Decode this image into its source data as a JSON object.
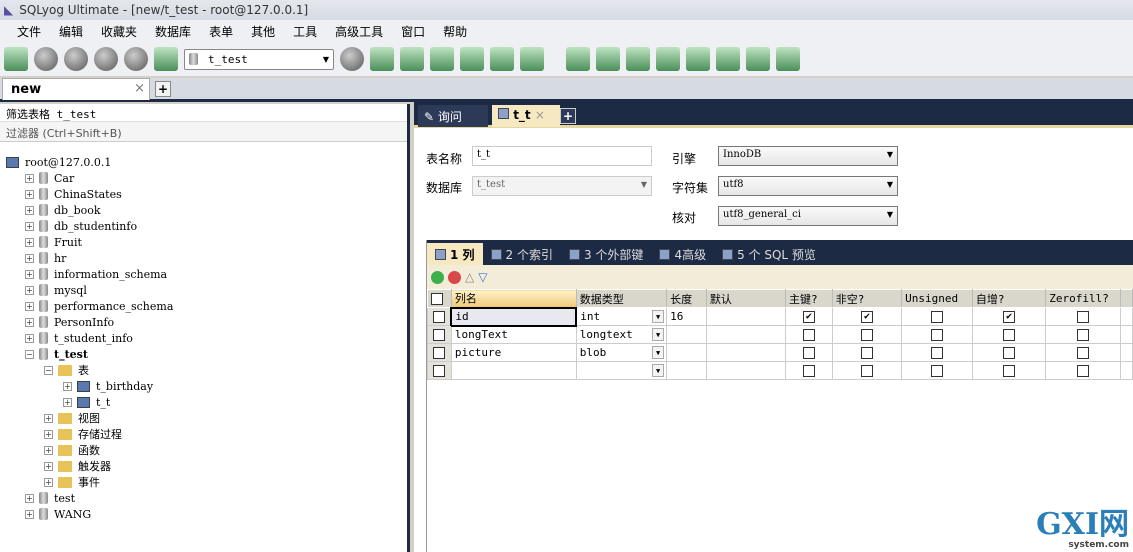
{
  "window": {
    "title": "SQLyog Ultimate - [new/t_test - root@127.0.0.1]"
  },
  "menu": [
    "文件",
    "编辑",
    "收藏夹",
    "数据库",
    "表单",
    "其他",
    "工具",
    "高级工具",
    "窗口",
    "帮助"
  ],
  "toolbar": {
    "db_select": "t_test"
  },
  "tabs": {
    "main": "new",
    "close": "×",
    "add": "+"
  },
  "left": {
    "filter_label": "筛选表格 t_test",
    "filter_placeholder": "过滤器 (Ctrl+Shift+B)",
    "tree": [
      {
        "label": "root@127.0.0.1",
        "level": 0,
        "kind": "server"
      },
      {
        "label": "Car",
        "level": 1,
        "kind": "db",
        "exp": "+"
      },
      {
        "label": "ChinaStates",
        "level": 1,
        "kind": "db",
        "exp": "+"
      },
      {
        "label": "db_book",
        "level": 1,
        "kind": "db",
        "exp": "+"
      },
      {
        "label": "db_studentinfo",
        "level": 1,
        "kind": "db",
        "exp": "+"
      },
      {
        "label": "Fruit",
        "level": 1,
        "kind": "db",
        "exp": "+"
      },
      {
        "label": "hr",
        "level": 1,
        "kind": "db",
        "exp": "+"
      },
      {
        "label": "information_schema",
        "level": 1,
        "kind": "db",
        "exp": "+"
      },
      {
        "label": "mysql",
        "level": 1,
        "kind": "db",
        "exp": "+"
      },
      {
        "label": "performance_schema",
        "level": 1,
        "kind": "db",
        "exp": "+"
      },
      {
        "label": "PersonInfo",
        "level": 1,
        "kind": "db",
        "exp": "+"
      },
      {
        "label": "t_student_info",
        "level": 1,
        "kind": "db",
        "exp": "+"
      },
      {
        "label": "t_test",
        "level": 1,
        "kind": "db",
        "exp": "−",
        "bold": true
      },
      {
        "label": "表",
        "level": 2,
        "kind": "folder",
        "exp": "−"
      },
      {
        "label": "t_birthday",
        "level": 3,
        "kind": "table",
        "exp": "+"
      },
      {
        "label": "t_t",
        "level": 3,
        "kind": "table",
        "exp": "+"
      },
      {
        "label": "视图",
        "level": 2,
        "kind": "folder",
        "exp": "+"
      },
      {
        "label": "存储过程",
        "level": 2,
        "kind": "folder",
        "exp": "+"
      },
      {
        "label": "函数",
        "level": 2,
        "kind": "folder",
        "exp": "+"
      },
      {
        "label": "触发器",
        "level": 2,
        "kind": "folder",
        "exp": "+"
      },
      {
        "label": "事件",
        "level": 2,
        "kind": "folder",
        "exp": "+"
      },
      {
        "label": "test",
        "level": 1,
        "kind": "db",
        "exp": "+"
      },
      {
        "label": "WANG",
        "level": 1,
        "kind": "db",
        "exp": "+"
      }
    ]
  },
  "right": {
    "tabs": {
      "query": "询问",
      "table": "t_t",
      "close": "×",
      "add": "+"
    },
    "form": {
      "table_name_label": "表名称",
      "table_name": "t_t",
      "database_label": "数据库",
      "database": "t_test",
      "engine_label": "引擎",
      "engine": "InnoDB",
      "charset_label": "字符集",
      "charset": "utf8",
      "collation_label": "核对",
      "collation": "utf8_general_ci"
    },
    "subtabs": [
      "1 列",
      "2 个索引",
      "3 个外部键",
      "4高级",
      "5 个 SQL 预览"
    ],
    "columns": [
      "列名",
      "数据类型",
      "长度",
      "默认",
      "主键?",
      "非空?",
      "Unsigned",
      "自增?",
      "Zerofill?"
    ],
    "rows": [
      {
        "name": "id",
        "type": "int",
        "length": "16",
        "default": "",
        "pk": true,
        "nn": true,
        "unsigned": false,
        "ai": true,
        "zf": false
      },
      {
        "name": "longText",
        "type": "longtext",
        "length": "",
        "default": "",
        "pk": false,
        "nn": false,
        "unsigned": false,
        "ai": false,
        "zf": false
      },
      {
        "name": "picture",
        "type": "blob",
        "length": "",
        "default": "",
        "pk": false,
        "nn": false,
        "unsigned": false,
        "ai": false,
        "zf": false
      },
      {
        "name": "",
        "type": "",
        "length": "",
        "default": "",
        "pk": false,
        "nn": false,
        "unsigned": false,
        "ai": false,
        "zf": false
      }
    ]
  },
  "watermark": {
    "logo": "GXI网",
    "site": "system.com"
  }
}
